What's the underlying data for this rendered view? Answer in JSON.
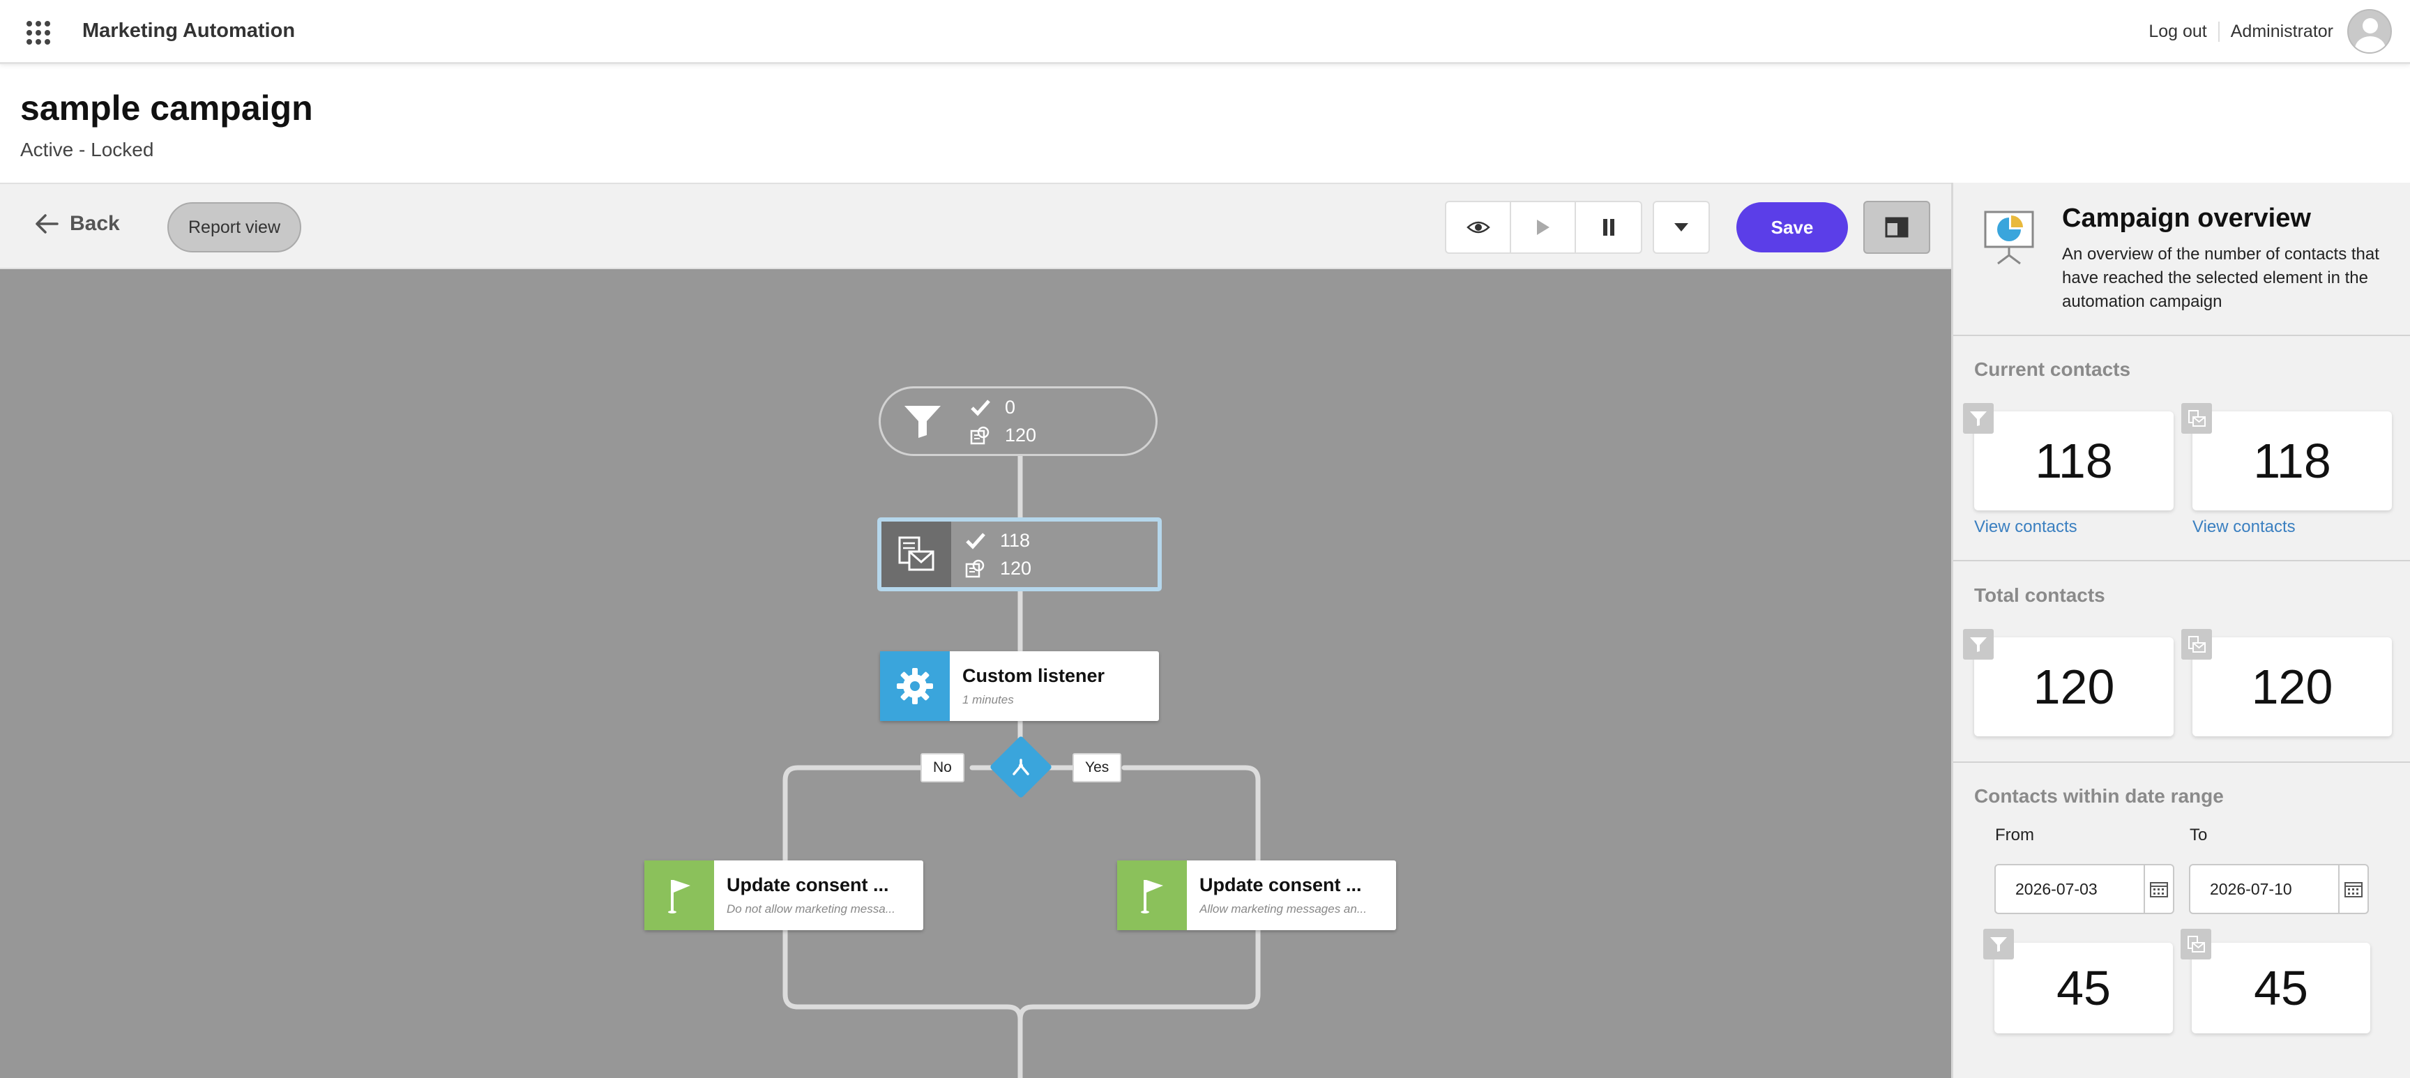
{
  "app": {
    "title": "Marketing Automation",
    "logout_label": "Log out",
    "user_name": "Administrator"
  },
  "campaign": {
    "title": "sample campaign",
    "status": "Active - Locked"
  },
  "toolbar": {
    "back_label": "Back",
    "report_view_label": "Report view",
    "save_label": "Save"
  },
  "canvas": {
    "filter_node": {
      "completed": "0",
      "total": "120"
    },
    "email_node": {
      "completed": "118",
      "total": "120"
    },
    "listener_node": {
      "name": "Custom listener",
      "detail": "1 minutes"
    },
    "decision": {
      "no_label": "No",
      "yes_label": "Yes"
    },
    "consent_left": {
      "name": "Update consent ...",
      "detail": "Do not allow marketing messa..."
    },
    "consent_right": {
      "name": "Update consent ...",
      "detail": "Allow marketing messages an..."
    }
  },
  "overview": {
    "title": "Campaign overview",
    "description": "An overview of the number of contacts that have reached the selected element in the automation campaign",
    "current": {
      "title": "Current contacts",
      "filter_value": "118",
      "email_value": "118",
      "view_label_1": "View contacts",
      "view_label_2": "View contacts"
    },
    "total": {
      "title": "Total contacts",
      "filter_value": "120",
      "email_value": "120"
    },
    "range": {
      "title": "Contacts within date range",
      "from_label": "From",
      "to_label": "To",
      "from_value": "2026-07-03",
      "to_value": "2026-07-10",
      "filter_value": "45",
      "email_value": "45"
    }
  },
  "colors": {
    "accent": "#5b3ee8",
    "canvas_bg": "#979797",
    "listener_blue": "#3aa5dc",
    "action_green": "#8bc15b",
    "link": "#3a7fc0"
  },
  "icons": [
    "apps-icon",
    "avatar-icon",
    "back-arrow-icon",
    "eye-icon",
    "play-icon",
    "pause-icon",
    "chevron-down-icon",
    "panel-icon",
    "funnel-icon",
    "email-icon",
    "checkmark-icon",
    "contacts-icon",
    "gear-icon",
    "flag-icon",
    "split-icon",
    "presentation-icon",
    "calendar-icon"
  ]
}
